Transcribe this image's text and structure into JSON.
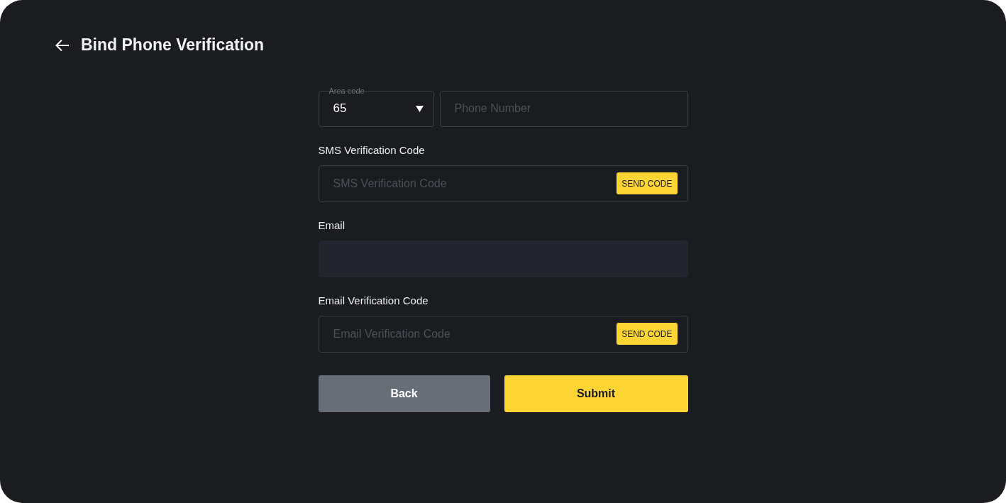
{
  "header": {
    "title": "Bind Phone Verification"
  },
  "phone": {
    "area_code": {
      "label": "Area code",
      "value": "65"
    },
    "phone_number": {
      "placeholder": "Phone Number"
    }
  },
  "fields": [
    {
      "kind": "code",
      "label": "SMS Verification Code",
      "placeholder": "SMS Verification Code",
      "button": "SEND CODE",
      "disabled": false
    },
    {
      "kind": "text",
      "label": "Email",
      "disabled": true
    },
    {
      "kind": "code",
      "label": "Email Verification Code",
      "placeholder": "Email Verification Code",
      "button": "SEND CODE",
      "disabled": false
    }
  ],
  "buttons": [
    {
      "kind": "secondary",
      "label": "Back"
    },
    {
      "kind": "primary",
      "label": "Submit"
    }
  ]
}
